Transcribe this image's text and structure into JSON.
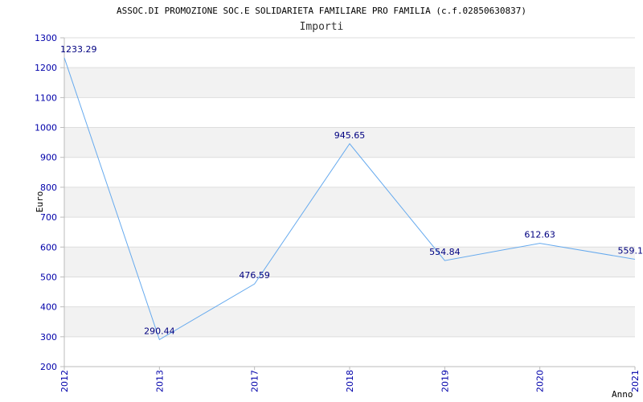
{
  "chart_data": {
    "type": "line",
    "title": "ASSOC.DI PROMOZIONE SOC.E SOLIDARIETA FAMILIARE PRO FAMILIA (c.f.02850630837)",
    "subtitle": "Importi",
    "xlabel": "Anno",
    "ylabel": "Euro",
    "categories": [
      "2012",
      "2013",
      "2017",
      "2018",
      "2019",
      "2020",
      "2021"
    ],
    "values": [
      1233.29,
      290.44,
      476.59,
      945.65,
      554.84,
      612.63,
      559.1
    ],
    "data_labels": [
      "1233.29",
      "290.44",
      "476.59",
      "945.65",
      "554.84",
      "612.63",
      "559.1"
    ],
    "ylim": [
      200,
      1300
    ],
    "yticks": [
      200,
      300,
      400,
      500,
      600,
      700,
      800,
      900,
      1000,
      1100,
      1200,
      1300
    ],
    "grid": true,
    "colors": {
      "line": "#66aaee",
      "tick_text": "#0000aa",
      "label_text": "#000080",
      "band": "#f2f2f2",
      "gridline": "#dddddd"
    }
  }
}
